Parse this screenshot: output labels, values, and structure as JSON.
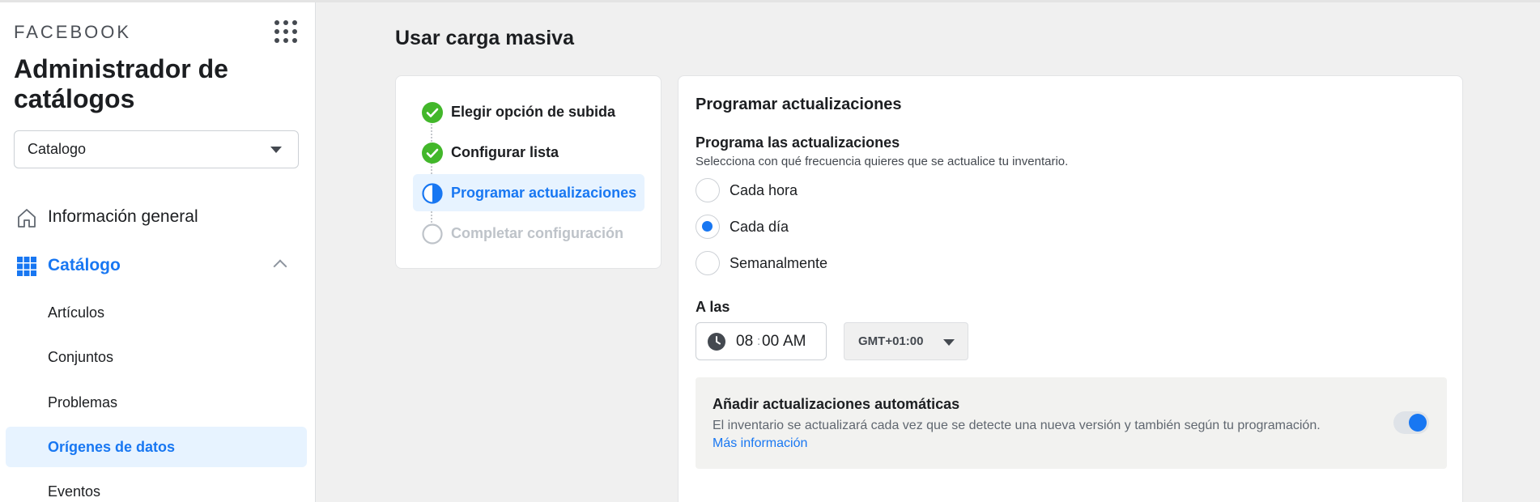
{
  "sidebar": {
    "brand": "FACEBOOK",
    "app_title": "Administrador de catálogos",
    "catalog_select": {
      "value": "Catalogo"
    },
    "nav": {
      "overview": "Información general",
      "catalog": "Catálogo"
    },
    "catalog_items": [
      "Artículos",
      "Conjuntos",
      "Problemas",
      "Orígenes de datos",
      "Eventos"
    ],
    "active_item": "Orígenes de datos",
    "icons": [
      "grid-apps-icon",
      "home-icon",
      "grid-icon",
      "chevron-up-icon",
      "caret-down-icon"
    ]
  },
  "main": {
    "title": "Usar carga masiva",
    "steps": [
      {
        "label": "Elegir opción de subida",
        "status": "done"
      },
      {
        "label": "Configurar lista",
        "status": "done"
      },
      {
        "label": "Programar actualizaciones",
        "status": "current"
      },
      {
        "label": "Completar configuración",
        "status": "pending"
      }
    ],
    "schedule": {
      "card_title": "Programar actualizaciones",
      "section_title": "Programa las actualizaciones",
      "section_desc": "Selecciona con qué frecuencia quieres que se actualice tu inventario.",
      "options": [
        "Cada hora",
        "Cada día",
        "Semanalmente"
      ],
      "selected": "Cada día",
      "at_label": "A las",
      "time": {
        "hour": "08",
        "separator": ":",
        "minute": "00",
        "ampm": "AM"
      },
      "timezone": "GMT+01:00",
      "auto_updates": {
        "title": "Añadir actualizaciones automáticas",
        "description": "El inventario se actualizará cada vez que se detecte una nueva versión y también según tu programación.",
        "link": "Más información",
        "enabled": true
      }
    }
  },
  "colors": {
    "accent": "#1877f2",
    "success": "#42b72a",
    "active_bg": "#e7f3ff",
    "page_bg": "#f0f0f0"
  }
}
